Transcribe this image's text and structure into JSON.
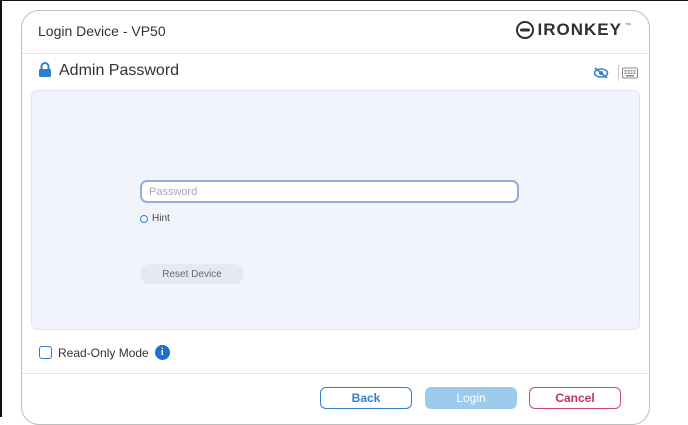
{
  "window": {
    "title": "Login Device - VP50",
    "brand": "IRONKEY",
    "brand_tm": "™"
  },
  "header": {
    "title": "Admin Password",
    "lock_icon": "lock-icon",
    "eye_icon": "eye-slash-icon",
    "keyboard_icon": "keyboard-icon"
  },
  "form": {
    "password_placeholder": "Password",
    "password_value": "",
    "hint_label": "Hint",
    "reset_label": "Reset Device"
  },
  "options": {
    "readonly_label": "Read-Only Mode",
    "readonly_checked": false,
    "info_glyph": "i"
  },
  "footer": {
    "back_label": "Back",
    "login_label": "Login",
    "cancel_label": "Cancel"
  },
  "colors": {
    "accent": "#2f7fce",
    "login_disabled": "#9ccbeb",
    "cancel": "#c0335f",
    "panel_bg": "#f1f5fb"
  }
}
